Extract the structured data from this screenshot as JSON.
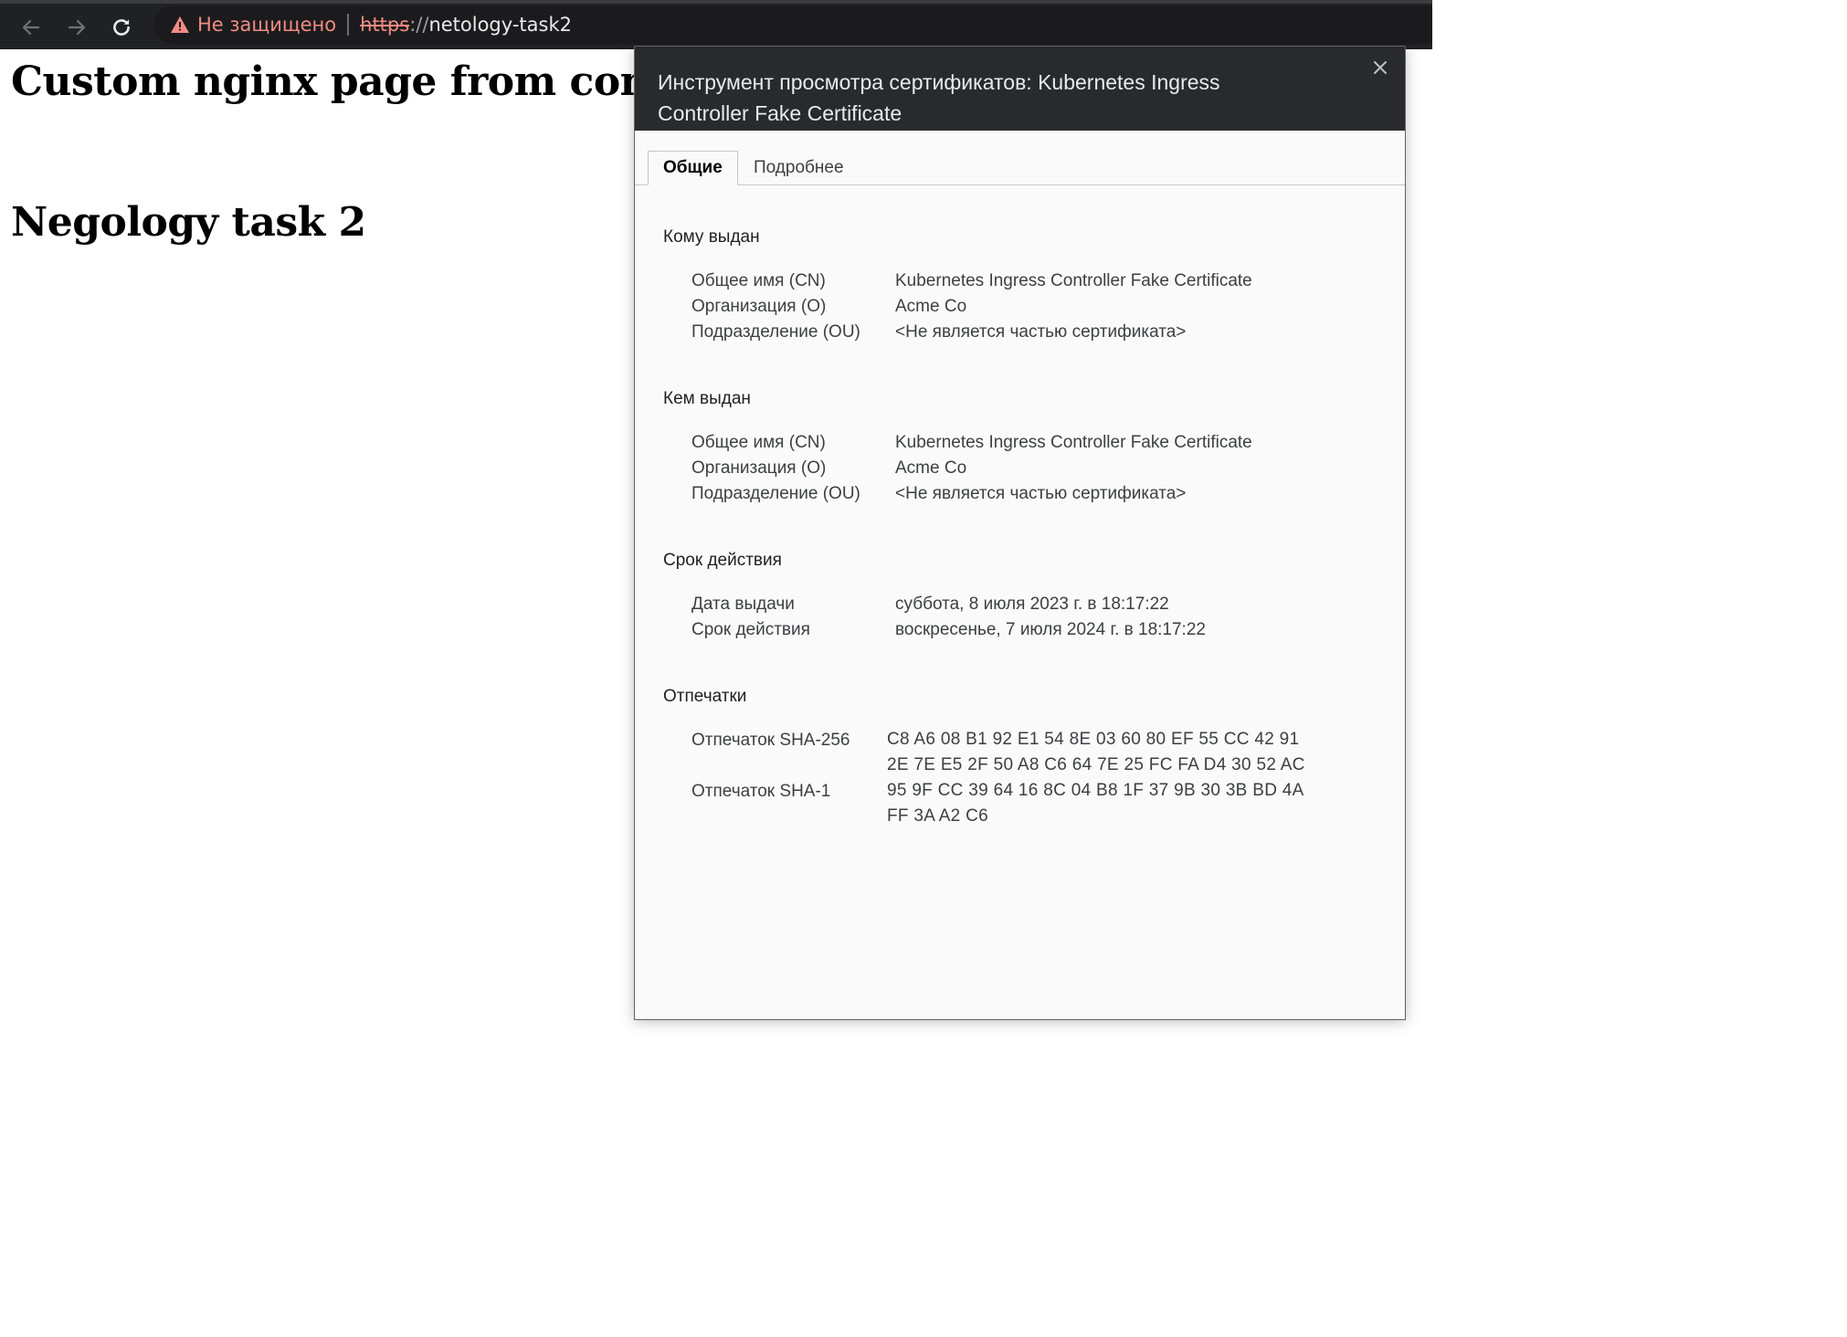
{
  "browser": {
    "back_icon": "arrow-left-icon",
    "forward_icon": "arrow-right-icon",
    "reload_icon": "reload-icon",
    "security_label": "Не защищено",
    "url_scheme": "https",
    "url_slashes": "://",
    "url_host": "netology-task2"
  },
  "page": {
    "heading1": "Custom nginx page from configm",
    "heading2": "Negology task 2"
  },
  "dialog": {
    "title": "Инструмент просмотра сертификатов: Kubernetes Ingress Controller Fake Certificate",
    "close_icon": "close-icon",
    "tabs": [
      {
        "label": "Общие",
        "active": true
      },
      {
        "label": "Подробнее",
        "active": false
      }
    ],
    "issued_to": {
      "title": "Кому выдан",
      "cn_label": "Общее имя (CN)",
      "cn_value": "Kubernetes Ingress Controller Fake Certificate",
      "o_label": "Организация (O)",
      "o_value": "Acme Co",
      "ou_label": "Подразделение (OU)",
      "ou_value": "<Не является частью сертификата>"
    },
    "issued_by": {
      "title": "Кем выдан",
      "cn_label": "Общее имя (CN)",
      "cn_value": "Kubernetes Ingress Controller Fake Certificate",
      "o_label": "Организация (O)",
      "o_value": "Acme Co",
      "ou_label": "Подразделение (OU)",
      "ou_value": "<Не является частью сертификата>"
    },
    "validity": {
      "title": "Срок действия",
      "issued_label": "Дата выдачи",
      "issued_value": "суббота, 8 июля 2023 г. в 18:17:22",
      "expires_label": "Срок действия",
      "expires_value": "воскресенье, 7 июля 2024 г. в 18:17:22"
    },
    "fingerprints": {
      "title": "Отпечатки",
      "sha256_label": "Отпечаток SHA-256",
      "sha256_value": "C8 A6 08 B1 92 E1 54 8E 03 60 80 EF 55 CC 42 91 2E 7E E5 2F 50 A8 C6 64 7E 25 FC FA D4 30 52 AC",
      "sha1_label": "Отпечаток SHA-1",
      "sha1_value": "95 9F CC 39 64 16 8C 04 B8 1F 37 9B 30 3B BD 4A FF 3A A2 C6"
    }
  },
  "colors": {
    "toolbar_bg": "#202124",
    "warning": "#f28b82",
    "dialog_header_bg": "#292a2d"
  }
}
